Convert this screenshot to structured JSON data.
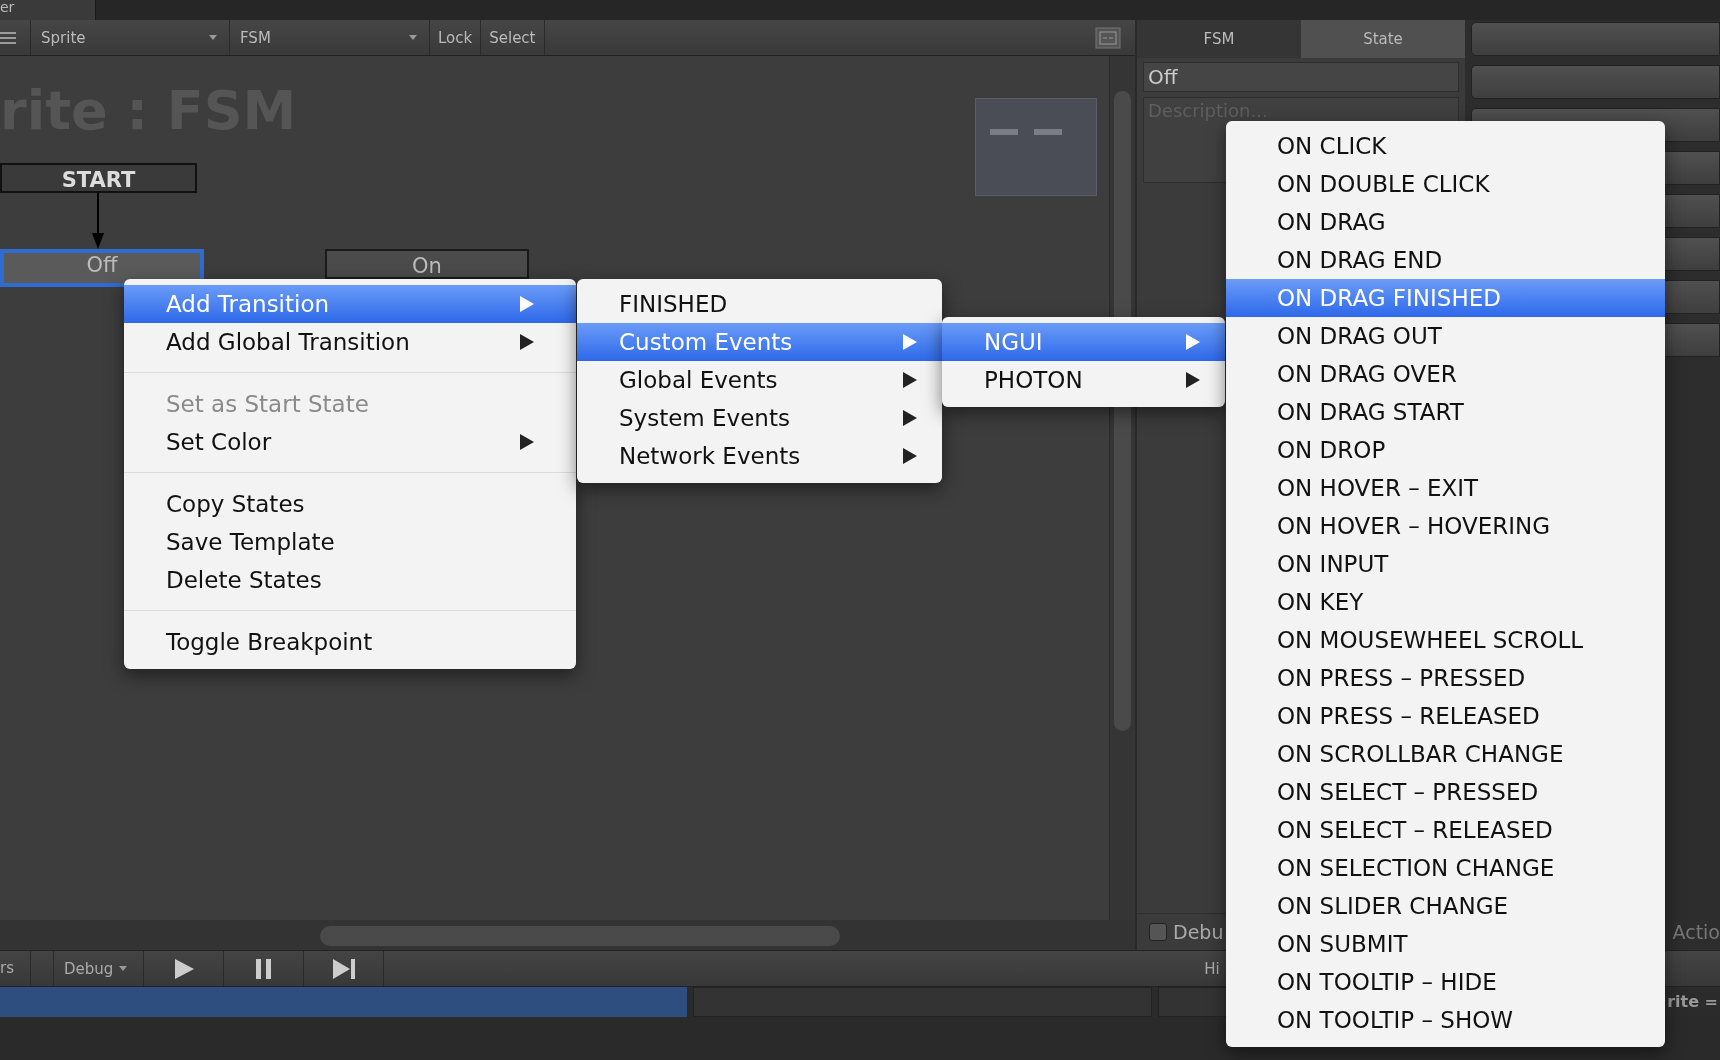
{
  "window_tab": "er",
  "toolbar": {
    "gameobject_dropdown": "Sprite",
    "fsm_dropdown": "FSM",
    "buttons": [
      "Lock",
      "Select"
    ]
  },
  "graph": {
    "title": "rite : FSM",
    "start_label": "START",
    "states": [
      {
        "name": "Off",
        "selected": true
      },
      {
        "name": "On",
        "selected": false
      }
    ]
  },
  "inspector": {
    "tabs": [
      {
        "label": "FSM",
        "selected": false
      },
      {
        "label": "State",
        "selected": true
      }
    ],
    "state_name": "Off",
    "description_placeholder": "Description...",
    "debug_checkbox": {
      "label": "Debu",
      "checked": false
    },
    "hint_label": "Hi"
  },
  "actions_label": "Actio",
  "bottom_toolbar": {
    "tab_partial": "rs",
    "debug_dropdown": "Debug"
  },
  "status_label": "rite =",
  "state_menu": {
    "sections": [
      [
        {
          "label": "Add Transition",
          "selected": true,
          "disabled": false,
          "submenu": true
        },
        {
          "label": "Add Global Transition",
          "selected": false,
          "disabled": false,
          "submenu": true
        }
      ],
      [
        {
          "label": "Set as Start State",
          "selected": false,
          "disabled": true,
          "submenu": false
        },
        {
          "label": "Set Color",
          "selected": false,
          "disabled": false,
          "submenu": true
        }
      ],
      [
        {
          "label": "Copy States",
          "selected": false,
          "disabled": false,
          "submenu": false
        },
        {
          "label": "Save Template",
          "selected": false,
          "disabled": false,
          "submenu": false
        },
        {
          "label": "Delete States",
          "selected": false,
          "disabled": false,
          "submenu": false
        }
      ],
      [
        {
          "label": "Toggle Breakpoint",
          "selected": false,
          "disabled": false,
          "submenu": false
        }
      ]
    ]
  },
  "transition_menu": [
    {
      "label": "FINISHED",
      "selected": false,
      "submenu": false
    },
    {
      "label": "Custom Events",
      "selected": true,
      "submenu": true
    },
    {
      "label": "Global Events",
      "selected": false,
      "submenu": true
    },
    {
      "label": "System Events",
      "selected": false,
      "submenu": true
    },
    {
      "label": "Network Events",
      "selected": false,
      "submenu": true
    }
  ],
  "custom_events_menu": [
    {
      "label": "NGUI",
      "selected": true,
      "submenu": true
    },
    {
      "label": "PHOTON",
      "selected": false,
      "submenu": true
    }
  ],
  "ngui_menu": [
    {
      "label": "ON CLICK",
      "selected": false
    },
    {
      "label": "ON DOUBLE CLICK",
      "selected": false
    },
    {
      "label": "ON DRAG",
      "selected": false
    },
    {
      "label": "ON DRAG END",
      "selected": false
    },
    {
      "label": "ON DRAG FINISHED",
      "selected": true
    },
    {
      "label": "ON DRAG OUT",
      "selected": false
    },
    {
      "label": "ON DRAG OVER",
      "selected": false
    },
    {
      "label": "ON DRAG START",
      "selected": false
    },
    {
      "label": "ON DROP",
      "selected": false
    },
    {
      "label": "ON HOVER – EXIT",
      "selected": false
    },
    {
      "label": "ON HOVER – HOVERING",
      "selected": false
    },
    {
      "label": "ON INPUT",
      "selected": false
    },
    {
      "label": "ON KEY",
      "selected": false
    },
    {
      "label": "ON MOUSEWHEEL SCROLL",
      "selected": false
    },
    {
      "label": "ON PRESS – PRESSED",
      "selected": false
    },
    {
      "label": "ON PRESS – RELEASED",
      "selected": false
    },
    {
      "label": "ON SCROLLBAR CHANGE",
      "selected": false
    },
    {
      "label": "ON SELECT – PRESSED",
      "selected": false
    },
    {
      "label": "ON SELECT – RELEASED",
      "selected": false
    },
    {
      "label": "ON SELECTION CHANGE",
      "selected": false
    },
    {
      "label": "ON SLIDER CHANGE",
      "selected": false
    },
    {
      "label": "ON SUBMIT",
      "selected": false
    },
    {
      "label": "ON TOOLTIP – HIDE",
      "selected": false
    },
    {
      "label": "ON TOOLTIP – SHOW",
      "selected": false
    }
  ]
}
